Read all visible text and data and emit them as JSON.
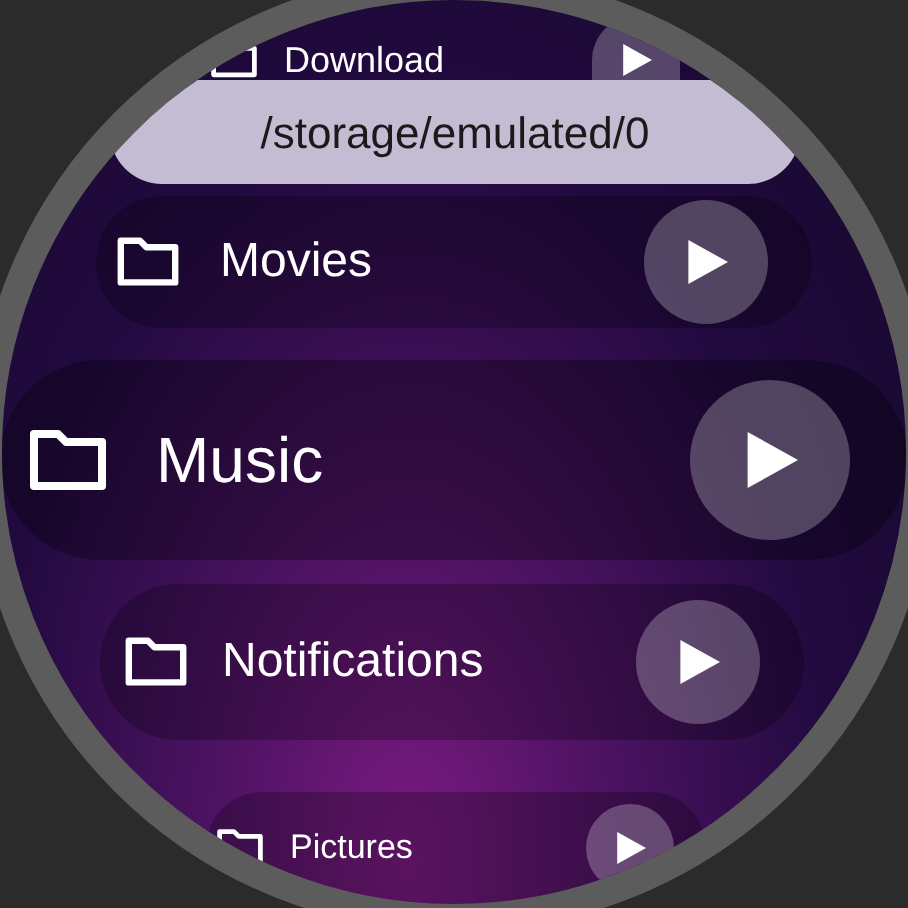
{
  "header": {
    "path": "/storage/emulated/0"
  },
  "folders": [
    {
      "label": "Download"
    },
    {
      "label": "Movies"
    },
    {
      "label": "Music"
    },
    {
      "label": "Notifications"
    },
    {
      "label": "Pictures"
    }
  ]
}
